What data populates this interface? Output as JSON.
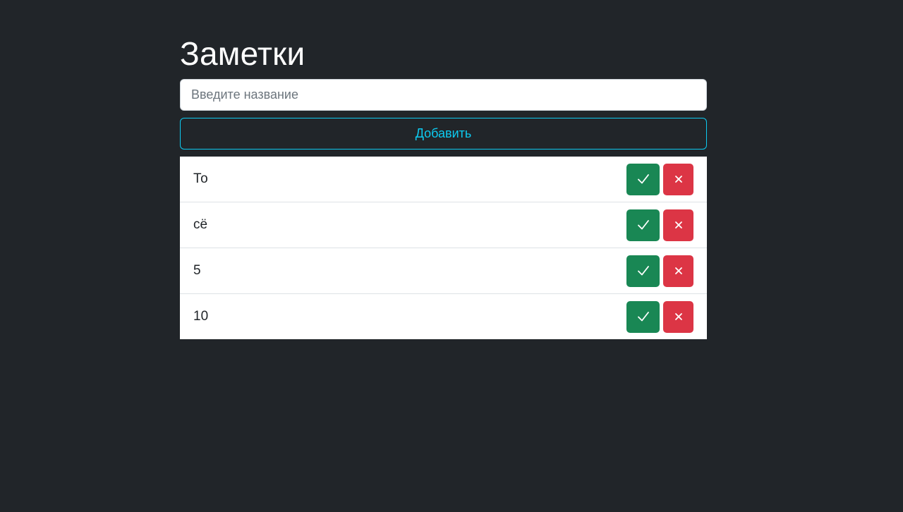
{
  "page": {
    "title": "Заметки"
  },
  "form": {
    "input_placeholder": "Введите название",
    "input_value": "",
    "add_label": "Добавить"
  },
  "notes": [
    {
      "text": "То",
      "done_icon": "check-icon",
      "delete_icon": "close-icon"
    },
    {
      "text": "сё",
      "done_icon": "check-icon",
      "delete_icon": "close-icon"
    },
    {
      "text": "5",
      "done_icon": "check-icon",
      "delete_icon": "close-icon"
    },
    {
      "text": "10",
      "done_icon": "check-icon",
      "delete_icon": "close-icon"
    }
  ],
  "colors": {
    "background": "#212529",
    "accent": "#0dcaf0",
    "success": "#198754",
    "danger": "#dc3545"
  }
}
